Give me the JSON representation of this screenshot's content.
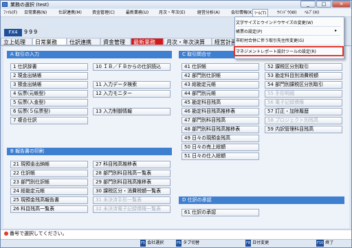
{
  "window": {
    "title": "業務の選択 (test)",
    "buttons": {
      "minimize": "_",
      "maximize": "□",
      "close": "✕"
    }
  },
  "menubar": [
    "ﾌｧｲﾙ(F)",
    "日常業務(N)",
    "仕訳連携(M)",
    "資金管理(C)",
    "最新業務(U)",
    "月次・年次(E)",
    "経営分析(A)",
    "会社情報(K)",
    "ﾂｰﾙ(T)",
    "ｳｲﾝﾄﾞｳ(W)",
    "ﾍﾙﾌﾟ(H)"
  ],
  "tools_menu": {
    "items": [
      {
        "label": "文字サイズとウインドウサイズの変更(W)"
      },
      {
        "label": "帳票の設定(P)",
        "submenu": true
      },
      {
        "label": "市町村合併に伴う取引先住所変更(G)"
      },
      {
        "label": "マネジメントレポート設計ツールの設定(R)",
        "highlighted": true
      }
    ]
  },
  "company": {
    "fx_label": "FX4",
    "number": "999"
  },
  "tabs": [
    "立上処理",
    "日常業務",
    "仕訳連携",
    "資金管理",
    "最新業務",
    "月次・年次決算",
    "経営計画"
  ],
  "active_tab": "日常業務",
  "sections": {
    "a": {
      "title": "A 取引の入力",
      "items": [
        "1 仕訳辞書",
        "2 現金出納帳",
        "3 預金出納帳",
        "4 伝票(元帳型)",
        "5 伝票(入金型)",
        "6 伝票(５伝票型)",
        "7 複合仕訳",
        "10 ＩＢ／ＦＢからの仕訳読込",
        "11 入力データ検索",
        "12 入力モニター",
        "13 入力制御情報"
      ]
    },
    "c": {
      "title": "C 取引問合せ",
      "items": [
        "41 仕訳帳",
        "42 部門別仕訳帳",
        "43 総勘定元帳",
        "44 部門別元帳",
        "45 勘定科目残高",
        "46 勘定科目残高推移表",
        "47 部門別科目残高",
        "48 部門別科目残高推移表",
        "49 日々の現預金残高",
        "50 日々の売上総額",
        "51 日々の仕入総額",
        "52 課税区分別取引",
        "53 勘定科目別消費税額",
        "54 部門別課税区分別取引",
        "55 手形明細",
        "56 電子記録債権",
        "57 訂正・加除履歴",
        "58 プロジェクト別残高",
        "59 内訳管理科目残高"
      ],
      "disabled": [
        "55 手形明細",
        "56 電子記録債権",
        "58 プロジェクト別残高"
      ]
    },
    "b": {
      "title": "B 報告書の印刷",
      "items": [
        "21 現預金出納帳",
        "22 仕訳帳",
        "23 部門別仕訳帳",
        "24 総勘定元帳",
        "25 現預金残高報告書",
        "26 科目残高一覧表",
        "27 科目残高推移表",
        "28 部門別科目残高一覧表",
        "29 部門別科目残高推移表",
        "30 課税区分・消費税額一覧表",
        "31 未決済手形一覧表",
        "32 未決済電子記録債権一覧表"
      ],
      "disabled": [
        "31 未決済手形一覧表",
        "32 未決済電子記録債権一覧表"
      ]
    },
    "d": {
      "title": "D 仕訳の承認",
      "items": [
        "61 仕訳の承認"
      ]
    }
  },
  "status": "番号で選択してください。",
  "fkeys": [
    {
      "key": "F5",
      "label": "会社選択"
    },
    {
      "key": "F6",
      "label": "タブ切替"
    },
    {
      "key": "F8",
      "label": "日付変更"
    },
    {
      "key": "F10",
      "label": "終了"
    }
  ],
  "colors": {
    "accent": "#3f7fd0",
    "brand": "#1e4f9a",
    "alert": "#e2342a"
  }
}
